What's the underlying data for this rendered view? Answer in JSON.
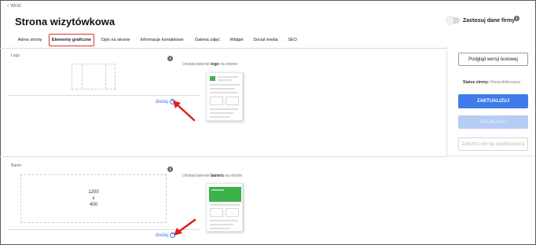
{
  "header": {
    "back_label": "Wróć",
    "title": "Strona wizytówkowa",
    "toggle_label": "Zastosuj dane firmy",
    "info_glyph": "i"
  },
  "tabs": [
    {
      "label": "Adres strony",
      "active": false
    },
    {
      "label": "Elementy graficzne",
      "active": true
    },
    {
      "label": "Opis na stronie",
      "active": false
    },
    {
      "label": "Informacje kontaktowe",
      "active": false
    },
    {
      "label": "Galeria zdjęć",
      "active": false
    },
    {
      "label": "Widget",
      "active": false
    },
    {
      "label": "Social media",
      "active": false
    },
    {
      "label": "SEO",
      "active": false
    }
  ],
  "sidebar": {
    "preview_button": "Podgląd wersji testowej",
    "status_label": "Status strony:",
    "status_value": "Nieopublikowana",
    "update_button": "ZAKTUALIZUJ",
    "publish_button": "OPUBLIKUJ",
    "unpublish_button": "Zakończ wersję opublikowaną"
  },
  "logo_section": {
    "label": "Logo",
    "add_label": "dodaj",
    "placement_prefix": "Umiejscowienie",
    "placement_bold": "logo",
    "placement_suffix": "na stronie"
  },
  "baner_section": {
    "label": "Baner",
    "size_width": "1200",
    "size_x": "x",
    "size_height": "400",
    "add_label": "dodaj",
    "placement_prefix": "Umiejscowienie",
    "placement_bold": "baneru",
    "placement_suffix": "na stronie"
  },
  "colors": {
    "accent": "#3f7bea",
    "highlight": "#e03030",
    "green": "#3bb34a"
  },
  "icons": {
    "back": "chevron-left-icon",
    "info": "info-icon",
    "add": "plus-circle-icon",
    "annotation": "red-arrow-icon"
  }
}
